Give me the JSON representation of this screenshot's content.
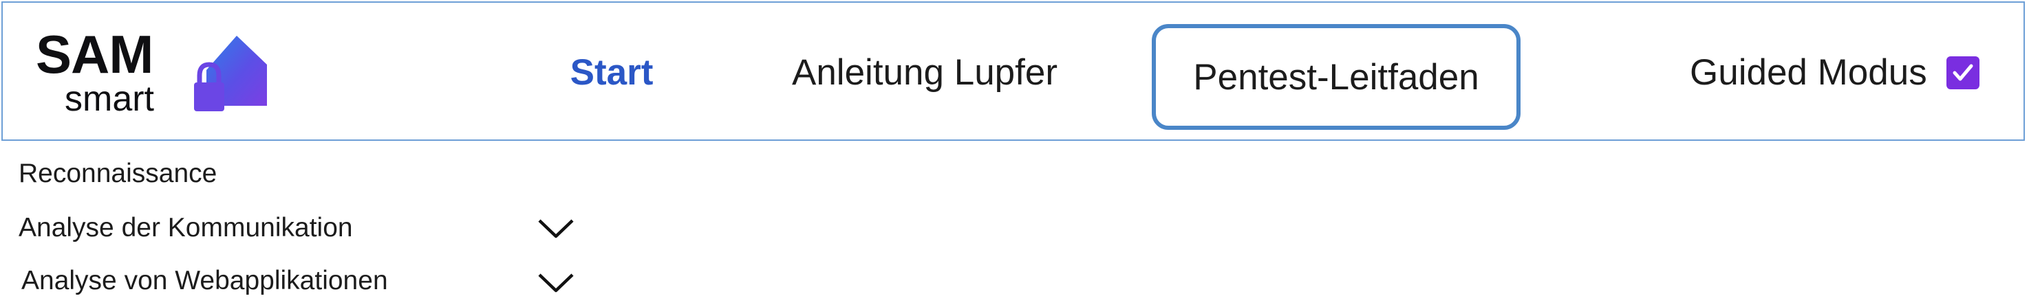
{
  "header": {
    "logo": {
      "line1": "SAM",
      "line2": "smart",
      "mark_icon": "house-lock-icon"
    },
    "nav": {
      "start": "Start",
      "anleitung": "Anleitung Lupfer",
      "pentest": "Pentest-Leitfaden"
    },
    "guided": {
      "label": "Guided Modus",
      "checked": true
    }
  },
  "menu": {
    "items": [
      {
        "label": "Reconnaissance",
        "expandable": false
      },
      {
        "label": "Analyse der Kommunikation",
        "expandable": true,
        "icon": "chevron-down-icon"
      },
      {
        "label": "Analyse von Webapplikationen",
        "expandable": true,
        "icon": "chevron-down-icon"
      }
    ]
  },
  "colors": {
    "accent": "#2b57c6",
    "focus_border": "#4a86c8",
    "header_border": "#6d9fd6",
    "checkbox": "#7a2ee0",
    "logo_gradient_start": "#1e88e5",
    "logo_gradient_end": "#7b3fe4"
  }
}
